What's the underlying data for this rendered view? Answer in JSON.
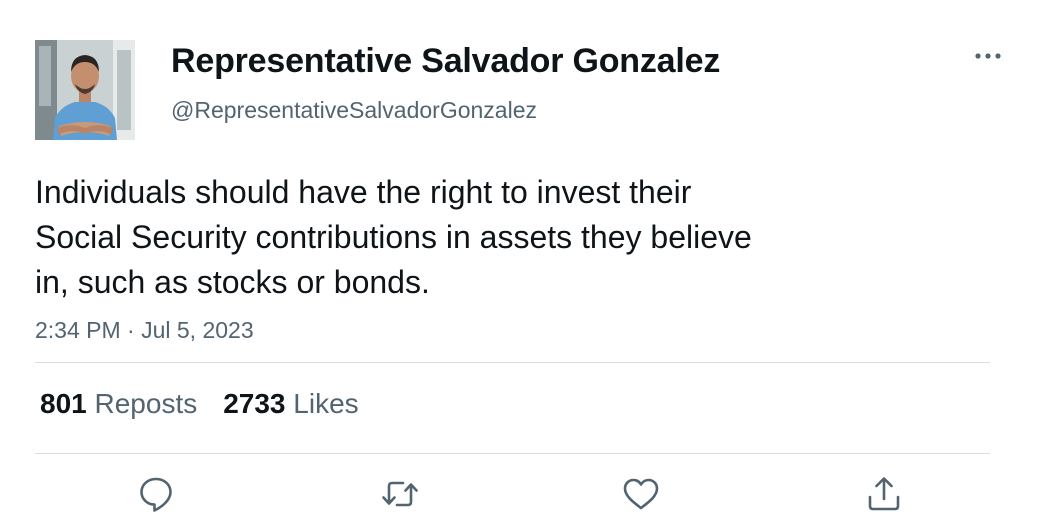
{
  "user": {
    "display_name": "Representative Salvador Gonzalez",
    "handle": "@RepresentativeSalvadorGonzalez",
    "avatar_icon": "profile-photo"
  },
  "tweet": {
    "text_lines": [
      "Individuals should have the right to invest their",
      "Social Security contributions in assets they believe",
      "in, such as stocks or bonds."
    ],
    "timestamp": "2:34 PM · Jul 5, 2023"
  },
  "stats": {
    "reposts_count": "801",
    "reposts_label": "Reposts",
    "likes_count": "2733",
    "likes_label": "Likes"
  },
  "actions": {
    "reply_icon": "reply-icon",
    "repost_icon": "repost-icon",
    "like_icon": "heart-icon",
    "share_icon": "share-icon",
    "more_icon": "more-dots-icon"
  },
  "colors": {
    "text": "#0f1419",
    "secondary": "#536471",
    "divider": "#d9dde1"
  }
}
